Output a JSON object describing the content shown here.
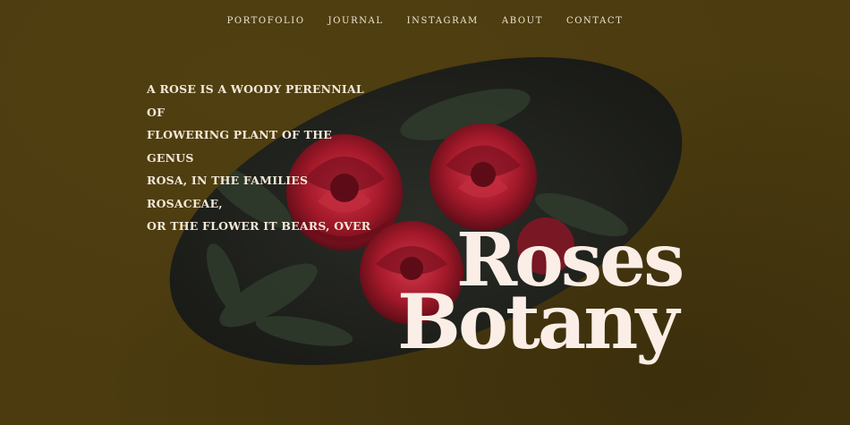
{
  "nav": {
    "items": [
      {
        "label": "PORTOFOLIO"
      },
      {
        "label": "JOURNAL"
      },
      {
        "label": "INSTAGRAM"
      },
      {
        "label": "ABOUT"
      },
      {
        "label": "CONTACT"
      }
    ]
  },
  "hero": {
    "intro_lines": [
      "A ROSE IS A WOODY PERENNIAL OF",
      "FLOWERING PLANT OF THE GENUS",
      "ROSA, IN THE FAMILIES ROSACEAE,",
      "OR THE FLOWER IT BEARS, OVER"
    ],
    "title_line1": "Roses",
    "title_line2": "Botany"
  },
  "colors": {
    "background": "#4b3b0f",
    "ellipse": "#1f1f1b",
    "rose": "#a3192a",
    "text": "#fbeee6"
  }
}
